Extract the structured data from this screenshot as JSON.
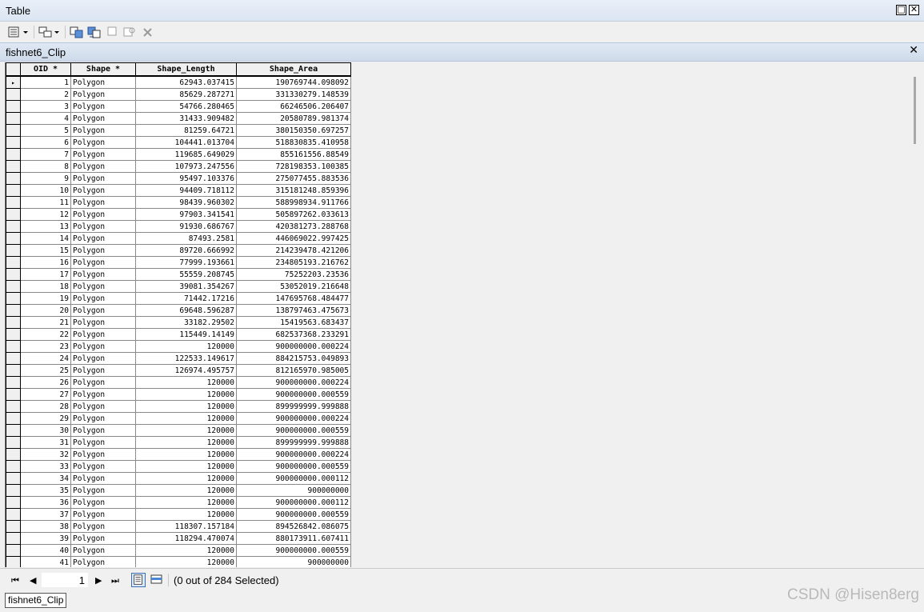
{
  "window": {
    "title": "Table",
    "minimize_glyph": "□",
    "close_glyph": "✕"
  },
  "toolbar": {
    "icons": [
      "table-options-icon",
      "related-tables-icon",
      "select-by-attributes-icon",
      "switch-selection-icon",
      "clear-selection-icon",
      "zoom-to-selected-icon",
      "delete-selected-icon"
    ]
  },
  "tab": {
    "title": "fishnet6_Clip",
    "close_glyph": "✕"
  },
  "grid": {
    "columns": [
      "OID *",
      "Shape *",
      "Shape_Length",
      "Shape_Area"
    ],
    "rows": [
      [
        "1",
        "Polygon",
        "62943.037415",
        "190769744.098092"
      ],
      [
        "2",
        "Polygon",
        "85629.287271",
        "331330279.148539"
      ],
      [
        "3",
        "Polygon",
        "54766.280465",
        "66246506.206407"
      ],
      [
        "4",
        "Polygon",
        "31433.909482",
        "20580789.981374"
      ],
      [
        "5",
        "Polygon",
        "81259.64721",
        "380150350.697257"
      ],
      [
        "6",
        "Polygon",
        "104441.013704",
        "518830835.410958"
      ],
      [
        "7",
        "Polygon",
        "119685.649029",
        "855161556.88549"
      ],
      [
        "8",
        "Polygon",
        "107973.247556",
        "728198353.100385"
      ],
      [
        "9",
        "Polygon",
        "95497.103376",
        "275077455.883536"
      ],
      [
        "10",
        "Polygon",
        "94409.718112",
        "315181248.859396"
      ],
      [
        "11",
        "Polygon",
        "98439.960302",
        "588998934.911766"
      ],
      [
        "12",
        "Polygon",
        "97903.341541",
        "505897262.033613"
      ],
      [
        "13",
        "Polygon",
        "91930.686767",
        "420381273.288768"
      ],
      [
        "14",
        "Polygon",
        "87493.2581",
        "446069022.997425"
      ],
      [
        "15",
        "Polygon",
        "89720.666992",
        "214239478.421206"
      ],
      [
        "16",
        "Polygon",
        "77999.193661",
        "234805193.216762"
      ],
      [
        "17",
        "Polygon",
        "55559.208745",
        "75252203.23536"
      ],
      [
        "18",
        "Polygon",
        "39081.354267",
        "53052019.216648"
      ],
      [
        "19",
        "Polygon",
        "71442.17216",
        "147695768.484477"
      ],
      [
        "20",
        "Polygon",
        "69648.596287",
        "138797463.475673"
      ],
      [
        "21",
        "Polygon",
        "33182.29502",
        "15419563.683437"
      ],
      [
        "22",
        "Polygon",
        "115449.14149",
        "682537368.233291"
      ],
      [
        "23",
        "Polygon",
        "120000",
        "900000000.000224"
      ],
      [
        "24",
        "Polygon",
        "122533.149617",
        "884215753.049893"
      ],
      [
        "25",
        "Polygon",
        "126974.495757",
        "812165970.985005"
      ],
      [
        "26",
        "Polygon",
        "120000",
        "900000000.000224"
      ],
      [
        "27",
        "Polygon",
        "120000",
        "900000000.000559"
      ],
      [
        "28",
        "Polygon",
        "120000",
        "899999999.999888"
      ],
      [
        "29",
        "Polygon",
        "120000",
        "900000000.000224"
      ],
      [
        "30",
        "Polygon",
        "120000",
        "900000000.000559"
      ],
      [
        "31",
        "Polygon",
        "120000",
        "899999999.999888"
      ],
      [
        "32",
        "Polygon",
        "120000",
        "900000000.000224"
      ],
      [
        "33",
        "Polygon",
        "120000",
        "900000000.000559"
      ],
      [
        "34",
        "Polygon",
        "120000",
        "900000000.000112"
      ],
      [
        "35",
        "Polygon",
        "120000",
        "900000000"
      ],
      [
        "36",
        "Polygon",
        "120000",
        "900000000.000112"
      ],
      [
        "37",
        "Polygon",
        "120000",
        "900000000.000559"
      ],
      [
        "38",
        "Polygon",
        "118307.157184",
        "894526842.086075"
      ],
      [
        "39",
        "Polygon",
        "118294.470074",
        "880173911.607411"
      ],
      [
        "40",
        "Polygon",
        "120000",
        "900000000.000559"
      ],
      [
        "41",
        "Polygon",
        "120000",
        "900000000"
      ]
    ],
    "current_row_marker": "▸"
  },
  "navigation": {
    "first_glyph": "⏮",
    "prev_glyph": "◀",
    "record_number": "1",
    "next_glyph": "▶",
    "last_glyph": "⏭",
    "status_text": "(0 out of 284 Selected)"
  },
  "bottom_tab": {
    "label": "fishnet6_Clip"
  },
  "watermark": "CSDN @Hisen8erg"
}
